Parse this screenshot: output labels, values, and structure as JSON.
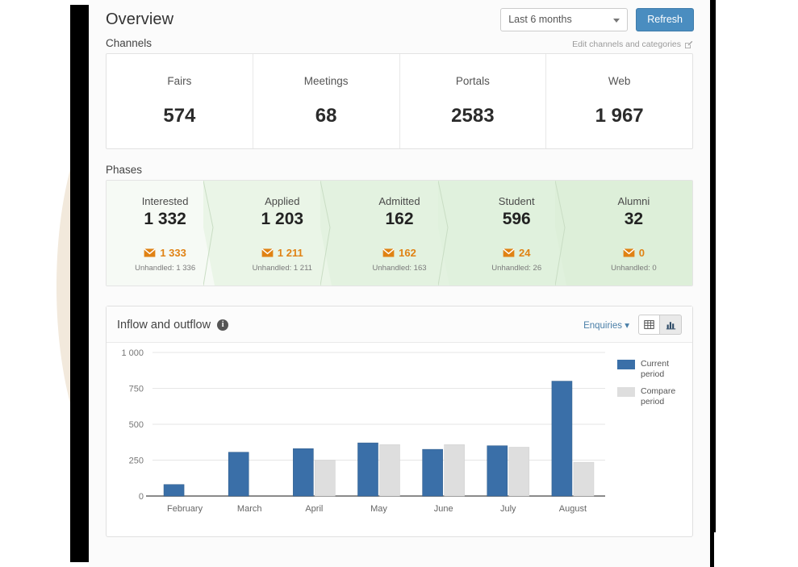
{
  "header": {
    "title": "Overview",
    "period_select": {
      "value": "Last 6 months",
      "icon": "chevron-down-icon"
    },
    "refresh_label": "Refresh"
  },
  "channels_section": {
    "label": "Channels",
    "edit_link": "Edit channels and categories",
    "edit_icon": "edit-pencil-square-icon",
    "cards": [
      {
        "name": "Fairs",
        "value": "574"
      },
      {
        "name": "Meetings",
        "value": "68"
      },
      {
        "name": "Portals",
        "value": "2583"
      },
      {
        "name": "Web",
        "value": "1 967"
      }
    ]
  },
  "phases_section": {
    "label": "Phases",
    "mail_icon": "envelope-icon",
    "accent_color": "#e08214",
    "phases": [
      {
        "name": "Interested",
        "value": "1 332",
        "mail": "1 333",
        "unhandled": "Unhandled: 1 336",
        "bg": "#f6faf5"
      },
      {
        "name": "Applied",
        "value": "1 203",
        "mail": "1 211",
        "unhandled": "Unhandled: 1 211",
        "bg": "#eaf5e7"
      },
      {
        "name": "Admitted",
        "value": "162",
        "mail": "162",
        "unhandled": "Unhandled: 163",
        "bg": "#e3f2e0"
      },
      {
        "name": "Student",
        "value": "596",
        "mail": "24",
        "unhandled": "Unhandled: 26",
        "bg": "#e0f1dd"
      },
      {
        "name": "Alumni",
        "value": "32",
        "mail": "0",
        "unhandled": "Unhandled: 0",
        "bg": "#ddefd9"
      }
    ]
  },
  "chart_card": {
    "title": "Inflow and outflow",
    "info_icon": "info-circle-icon",
    "info_glyph": "i",
    "enquiries_label": "Enquiries",
    "enquiries_caret": "caret-down-icon",
    "view_table_icon": "table-view-icon",
    "view_chart_icon": "bar-chart-view-icon",
    "active_view": "chart"
  },
  "chart_data": {
    "type": "bar",
    "title": "Inflow and outflow",
    "xlabel": "",
    "ylabel": "",
    "ylim": [
      0,
      1000
    ],
    "yticks": [
      0,
      250,
      500,
      750,
      1000
    ],
    "ytick_labels": [
      "0",
      "250",
      "500",
      "750",
      "1 000"
    ],
    "grid": true,
    "legend_position": "right",
    "categories": [
      "February",
      "March",
      "April",
      "May",
      "June",
      "July",
      "August"
    ],
    "series": [
      {
        "name": "Current period",
        "color": "#3a6fa8",
        "values": [
          80,
          305,
          330,
          370,
          325,
          350,
          800
        ]
      },
      {
        "name": "Compare period",
        "color": "#dedede",
        "values": [
          0,
          0,
          250,
          358,
          358,
          340,
          235
        ]
      }
    ]
  }
}
